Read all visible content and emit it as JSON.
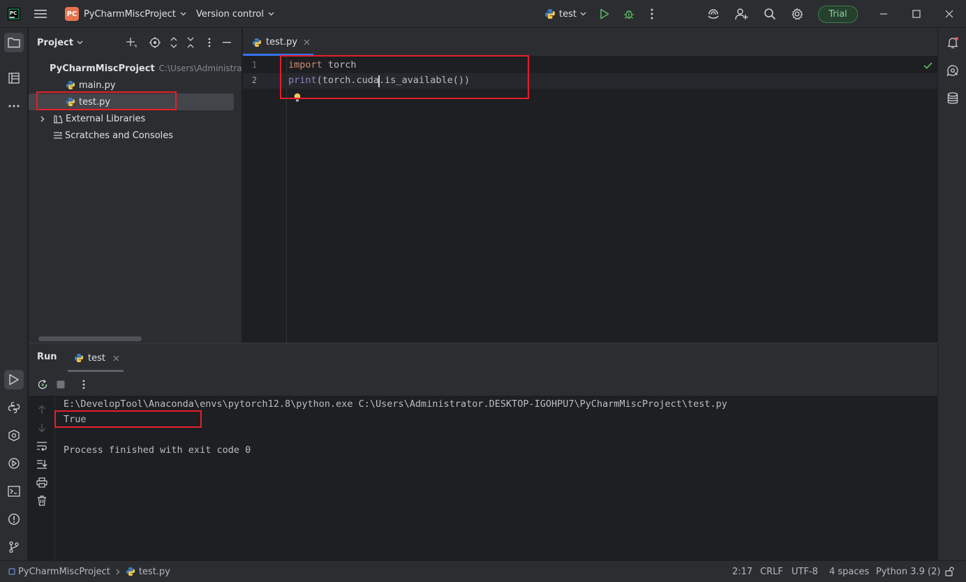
{
  "titlebar": {
    "project_badge": "PC",
    "project_name": "PyCharmMiscProject",
    "vcs_label": "Version control",
    "run_config": "test",
    "trial_label": "Trial"
  },
  "project_panel": {
    "title": "Project",
    "root_name": "PyCharmMiscProject",
    "root_path": "C:\\Users\\Administrator",
    "files": [
      "main.py",
      "test.py"
    ],
    "external_libraries": "External Libraries",
    "scratches": "Scratches and Consoles"
  },
  "editor": {
    "tab_label": "test.py",
    "line_numbers": [
      "1",
      "2"
    ],
    "line1": {
      "keyword": "import",
      "rest": " torch"
    },
    "line2": {
      "builtin": "print",
      "rest": "(torch.cuda.is_available())"
    }
  },
  "run": {
    "title": "Run",
    "tab_label": "test",
    "command": "E:\\DevelopTool\\Anaconda\\envs\\pytorch12.8\\python.exe C:\\Users\\Administrator.DESKTOP-IGOHPU7\\PyCharmMiscProject\\test.py",
    "result": "True",
    "exit_message": "Process finished with exit code 0"
  },
  "statusbar": {
    "breadcrumb_project": "PyCharmMiscProject",
    "breadcrumb_file": "test.py",
    "position": "2:17",
    "line_ending": "CRLF",
    "encoding": "UTF-8",
    "indent": "4 spaces",
    "interpreter": "Python 3.9 (2)"
  },
  "colors": {
    "accent_blue": "#3574f0",
    "run_green": "#5fb865",
    "highlight_red": "#e5202a"
  }
}
